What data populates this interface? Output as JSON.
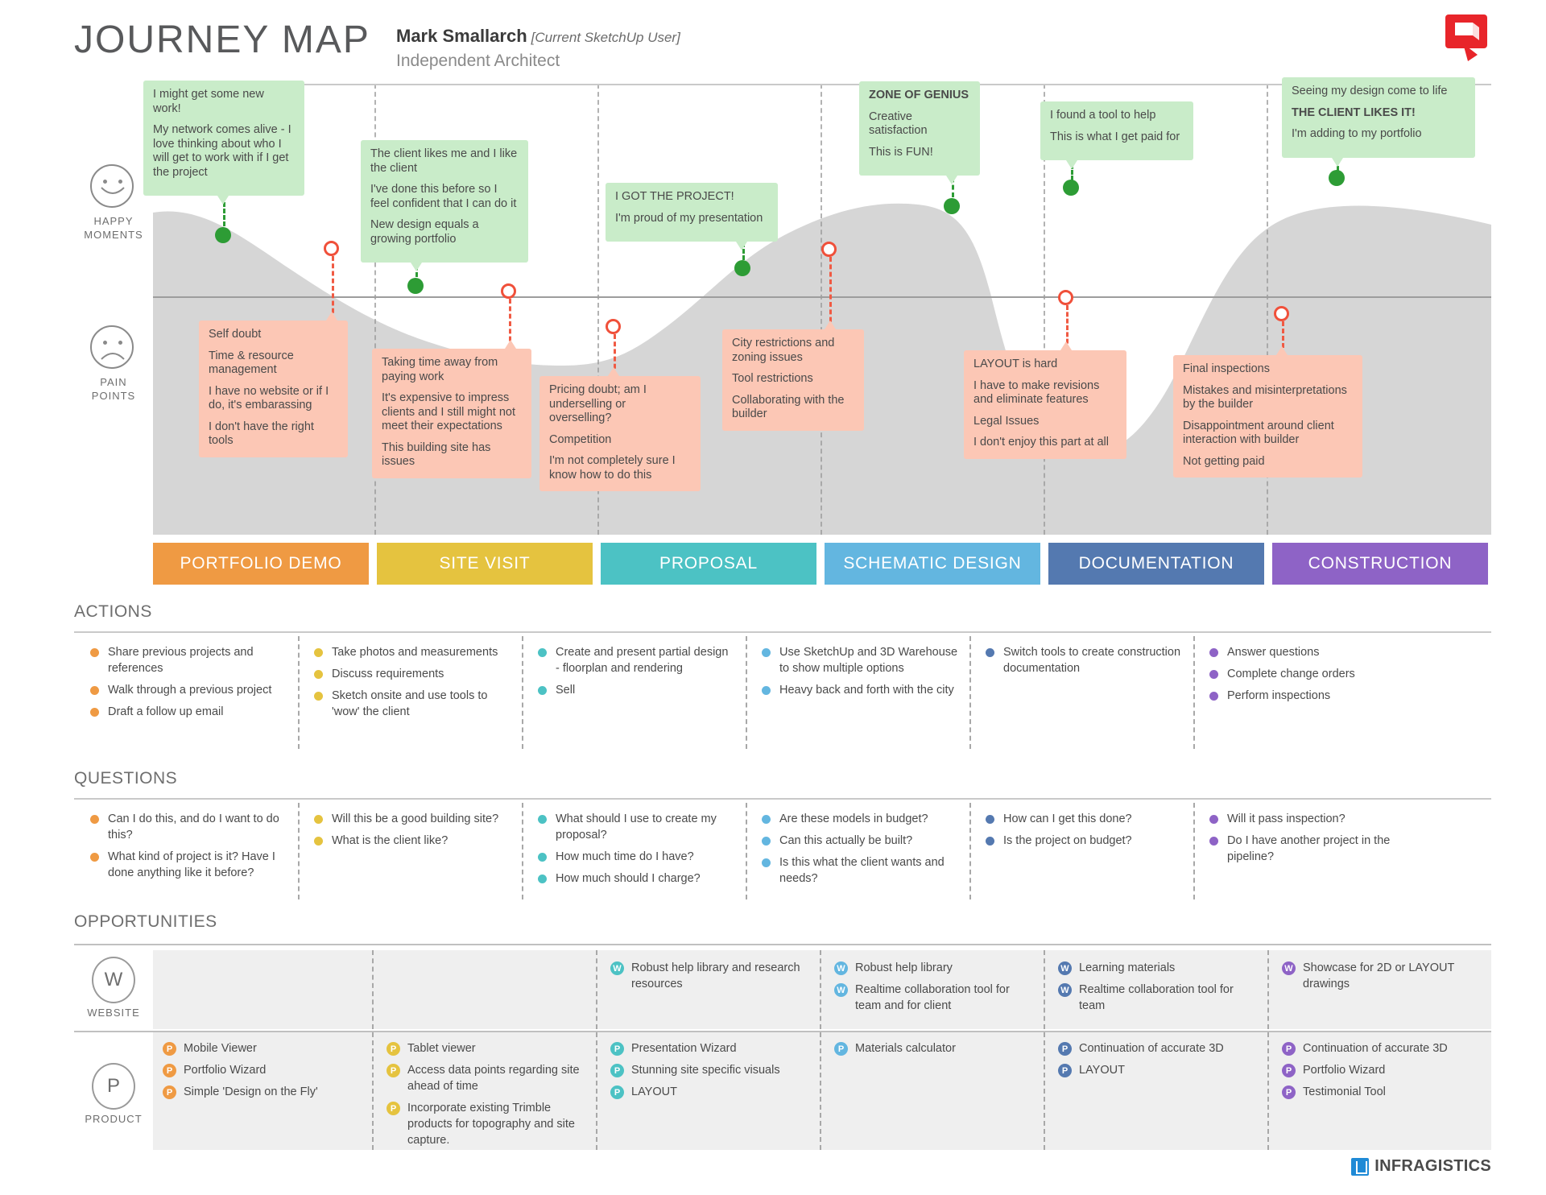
{
  "header": {
    "title": "JOURNEY MAP",
    "persona_name": "Mark Smallarch",
    "persona_tag": "[Current SketchUp User]",
    "persona_role": "Independent Architect",
    "logo_icon": "sketchup-logo"
  },
  "axis": {
    "happy_label_line1": "HAPPY",
    "happy_label_line2": "MOMENTS",
    "pain_label_line1": "PAIN",
    "pain_label_line2": "POINTS"
  },
  "happy_moments": [
    {
      "lines": [
        {
          "text": "I might get some new work!",
          "bold": false
        },
        {
          "text": "My network comes alive - I love thinking about who I will get to work with if I get the project",
          "bold": false
        }
      ]
    },
    {
      "lines": [
        {
          "text": "The client likes me and I like the client",
          "bold": false
        },
        {
          "text": "I've done this before so I feel confident that I can do it",
          "bold": false
        },
        {
          "text": "New design equals a growing portfolio",
          "bold": false
        }
      ]
    },
    {
      "lines": [
        {
          "text": "I GOT THE PROJECT!",
          "bold": false
        },
        {
          "text": "I'm proud of my presentation",
          "bold": false
        }
      ]
    },
    {
      "lines": [
        {
          "text": "ZONE OF GENIUS",
          "bold": true
        },
        {
          "text": "Creative satisfaction",
          "bold": false
        },
        {
          "text": "This is FUN!",
          "bold": false
        }
      ]
    },
    {
      "lines": [
        {
          "text": "I found a tool to help",
          "bold": false
        },
        {
          "text": "This is what I get paid for",
          "bold": false
        }
      ]
    },
    {
      "lines": [
        {
          "text": "Seeing my design come to life",
          "bold": false
        },
        {
          "text": "THE CLIENT LIKES IT!",
          "bold": true
        },
        {
          "text": "I'm adding to my portfolio",
          "bold": false
        }
      ]
    }
  ],
  "pain_points": [
    {
      "lines": [
        {
          "text": "Self doubt"
        },
        {
          "text": "Time & resource management"
        },
        {
          "text": "I have no website or if I do, it's embarassing"
        },
        {
          "text": "I don't have the right tools"
        }
      ]
    },
    {
      "lines": [
        {
          "text": "Taking time away from paying work"
        },
        {
          "text": "It's expensive to impress clients and I still might not meet their expectations"
        },
        {
          "text": "This building site has issues"
        }
      ]
    },
    {
      "lines": [
        {
          "text": "Pricing doubt; am I underselling or overselling?"
        },
        {
          "text": "Competition"
        },
        {
          "text": "I'm not completely sure I know how to do this"
        }
      ]
    },
    {
      "lines": [
        {
          "text": "City restrictions and zoning issues"
        },
        {
          "text": "Tool restrictions"
        },
        {
          "text": "Collaborating with the builder"
        }
      ]
    },
    {
      "lines": [
        {
          "text": "LAYOUT is hard"
        },
        {
          "text": "I have to make revisions and eliminate features"
        },
        {
          "text": "Legal Issues"
        },
        {
          "text": "I don't enjoy this part at all"
        }
      ]
    },
    {
      "lines": [
        {
          "text": "Final inspections"
        },
        {
          "text": "Mistakes and misinterpretations by the builder"
        },
        {
          "text": "Disappointment around client interaction with builder"
        },
        {
          "text": "Not getting paid"
        }
      ]
    }
  ],
  "phases": [
    {
      "label": "PORTFOLIO DEMO",
      "color": "#ef9a43"
    },
    {
      "label": "SITE VISIT",
      "color": "#e5c game"
    },
    {
      "label": "PROPOSAL",
      "color": "#4cc2c4"
    },
    {
      "label": "SCHEMATIC DESIGN",
      "color": "#63b6e0"
    },
    {
      "label": "DOCUMENTATION",
      "color": "#5479b0"
    },
    {
      "label": "CONSTRUCTION",
      "color": "#8e63c6"
    }
  ],
  "phase_colors": [
    "#ef9a43",
    "#e5c33f",
    "#4cc2c4",
    "#63b6e0",
    "#5479b0",
    "#8e63c6"
  ],
  "sections": {
    "actions_title": "ACTIONS",
    "questions_title": "QUESTIONS",
    "opportunities_title": "OPPORTUNITIES"
  },
  "actions": [
    [
      "Share previous projects and references",
      "Walk through a previous project",
      "Draft a follow up email"
    ],
    [
      "Take photos and measurements",
      "Discuss requirements",
      "Sketch onsite and use tools to 'wow' the client"
    ],
    [
      "Create and present partial design - floorplan and rendering",
      "Sell"
    ],
    [
      "Use SketchUp and 3D Warehouse to show multiple options",
      "Heavy back and forth with the city"
    ],
    [
      "Switch tools to create construction documentation"
    ],
    [
      "Answer questions",
      "Complete change orders",
      "Perform inspections"
    ]
  ],
  "questions": [
    [
      "Can I do this, and do I want to do this?",
      "What kind of project is it? Have I done anything like it before?"
    ],
    [
      "Will this be a good building site?",
      "What is the client like?"
    ],
    [
      "What should I use to create my proposal?",
      "How much time do I have?",
      "How much should I charge?"
    ],
    [
      "Are these models in budget?",
      "Can this actually be built?",
      "Is this what the client wants and needs?"
    ],
    [
      "How can I get this done?",
      "Is the project on budget?"
    ],
    [
      "Will it pass inspection?",
      "Do I have another project in the pipeline?"
    ]
  ],
  "opportunities": {
    "website_badge": "W",
    "website_label": "WEBSITE",
    "product_badge": "P",
    "product_label": "PRODUCT",
    "website": [
      [],
      [],
      [
        "Robust help library and research resources"
      ],
      [
        "Robust help library",
        "Realtime collaboration tool for team and for client"
      ],
      [
        "Learning materials",
        "Realtime collaboration tool for team"
      ],
      [
        "Showcase for 2D or LAYOUT drawings"
      ]
    ],
    "product": [
      [
        "Mobile Viewer",
        "Portfolio Wizard",
        "Simple 'Design on the Fly'"
      ],
      [
        "Tablet viewer",
        "Access data points regarding site ahead of time",
        "Incorporate existing Trimble products for topography and site capture."
      ],
      [
        "Presentation Wizard",
        "Stunning site specific visuals",
        "LAYOUT"
      ],
      [
        "Materials calculator"
      ],
      [
        "Continuation of accurate 3D",
        "LAYOUT"
      ],
      [
        "Continuation of accurate 3D",
        "Portfolio Wizard",
        "Testimonial Tool"
      ]
    ]
  },
  "footer": {
    "brand": "INFRAGISTICS",
    "brand_icon": "infragistics-logo"
  }
}
